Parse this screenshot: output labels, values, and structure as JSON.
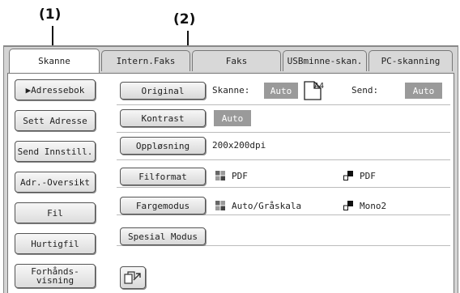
{
  "callouts": {
    "one": "(1)",
    "two": "(2)"
  },
  "tabs": [
    "Skanne",
    "Intern.Faks",
    "Faks",
    "USBminne-skan.",
    "PC-skanning"
  ],
  "sidebar": [
    {
      "label": "▶Adressebok"
    },
    {
      "label": "Sett Adresse"
    },
    {
      "label": "Send Innstill."
    },
    {
      "label": "Adr.-Oversikt"
    },
    {
      "label": "Fil"
    },
    {
      "label": "Hurtigfil"
    },
    {
      "label_line1": "Forhånds-",
      "label_line2": "visning"
    }
  ],
  "settings": {
    "original": {
      "button": "Original",
      "scan_label": "Skanne:",
      "scan_value": "Auto",
      "paper": "A4",
      "send_label": "Send:",
      "send_value": "Auto"
    },
    "contrast": {
      "button": "Kontrast",
      "value": "Auto"
    },
    "resolution": {
      "button": "Oppløsning",
      "value": "200x200dpi"
    },
    "file_format": {
      "button": "Filformat",
      "color_value": "PDF",
      "mono_value": "PDF"
    },
    "color_mode": {
      "button": "Fargemodus",
      "color_value": "Auto/Gråskala",
      "mono_value": "Mono2"
    },
    "special_modes": {
      "button": "Spesial Modus"
    }
  },
  "icons": {
    "color_mode_icon": "four-square-color-icon",
    "mono_mode_icon": "black-white-squares-icon",
    "preview": "preview-scan-icon"
  }
}
